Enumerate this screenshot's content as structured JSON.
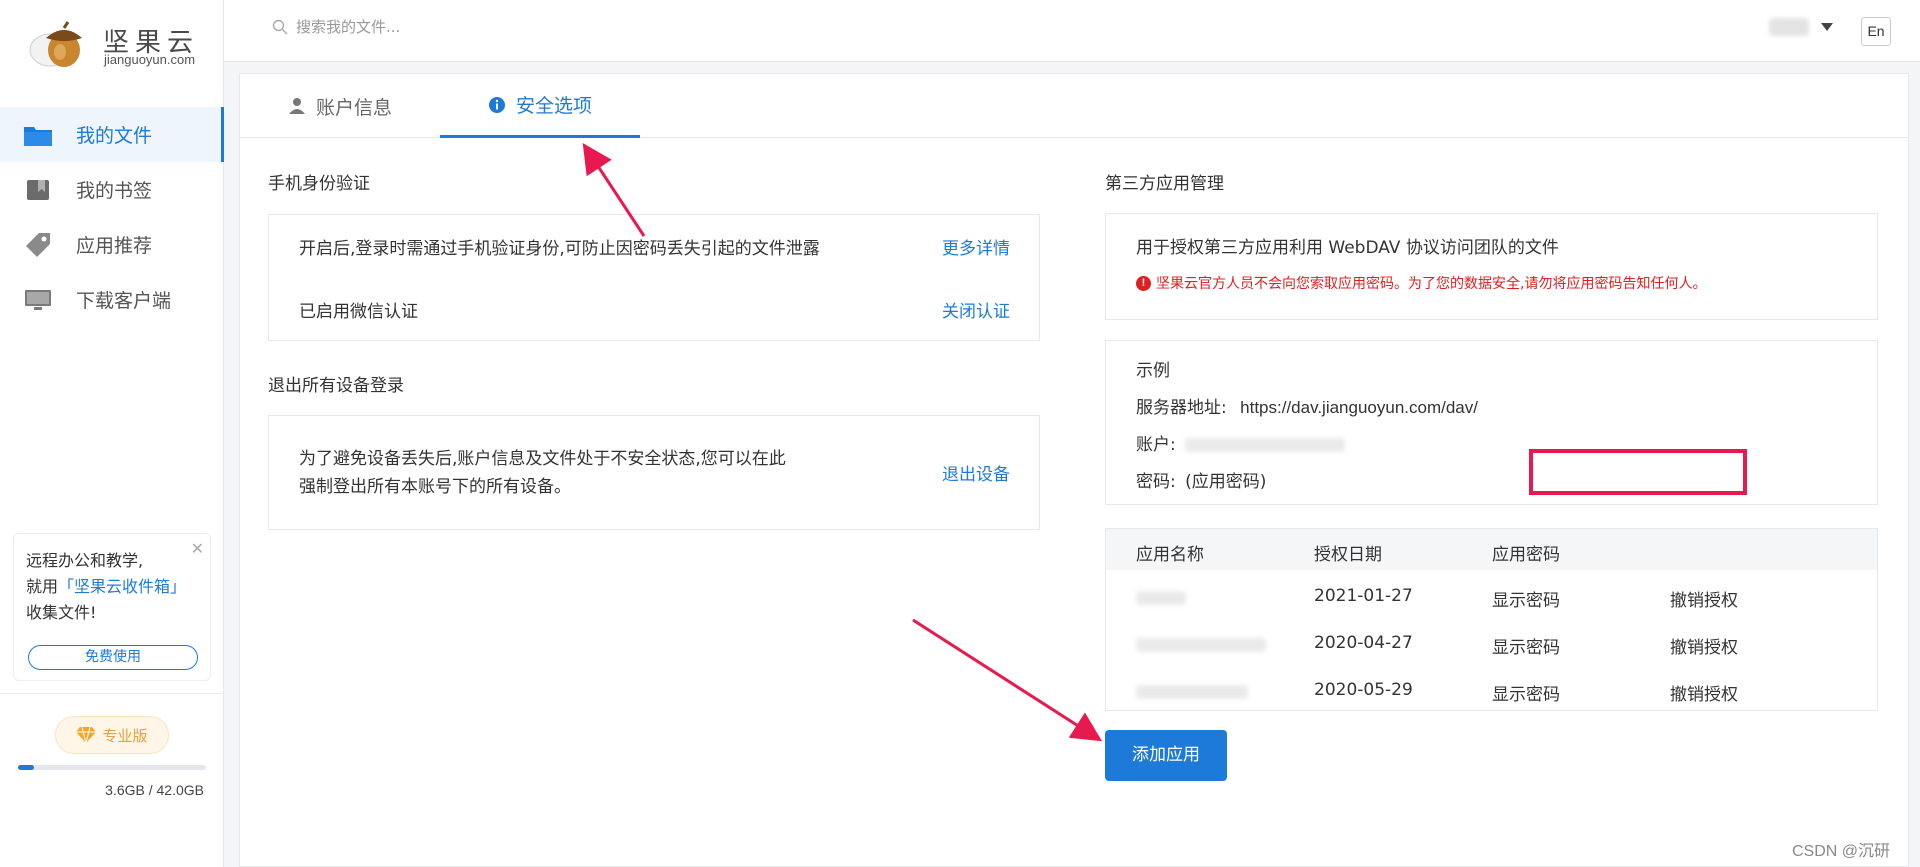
{
  "brand": {
    "name": "坚果云",
    "domain": "jianguoyun.com"
  },
  "sidebar": {
    "items": [
      {
        "label": "我的文件",
        "icon": "folder-icon",
        "active": true
      },
      {
        "label": "我的书签",
        "icon": "bookmark-icon",
        "active": false
      },
      {
        "label": "应用推荐",
        "icon": "tag-icon",
        "active": false
      },
      {
        "label": "下载客户端",
        "icon": "monitor-icon",
        "active": false
      }
    ],
    "promo": {
      "line1": "远程办公和教学,",
      "line2_prefix": "就用",
      "line2_highlight": "「坚果云收件箱」",
      "line3": "收集文件!",
      "close": "✕",
      "button": "免费使用"
    },
    "plan": {
      "label": "专业版",
      "icon": "diamond-icon"
    },
    "quota": {
      "text": "3.6GB / 42.0GB",
      "fraction": 0.0857
    }
  },
  "topbar": {
    "search_placeholder": "搜索我的文件...",
    "lang": "En"
  },
  "tabs": [
    {
      "label": "账户信息",
      "icon": "user-icon",
      "active": false
    },
    {
      "label": "安全选项",
      "icon": "info-icon",
      "active": true
    }
  ],
  "phone_auth": {
    "title": "手机身份验证",
    "desc": "开启后,登录时需通过手机验证身份,可防止因密码丢失引起的文件泄露",
    "more": "更多详情",
    "status": "已启用微信认证",
    "close": "关闭认证"
  },
  "logout_all": {
    "title": "退出所有设备登录",
    "desc_line1": "为了避免设备丢失后,账户信息及文件处于不安全状态,您可以在此",
    "desc_line2": "强制登出所有本账号下的所有设备。",
    "action": "退出设备"
  },
  "third_party": {
    "title": "第三方应用管理",
    "desc": "用于授权第三方应用利用 WebDAV 协议访问团队的文件",
    "warning": "坚果云官方人员不会向您索取应用密码。为了您的数据安全,请勿将应用密码告知任何人。",
    "example": {
      "title": "示例",
      "server_label": "服务器地址:",
      "server_url": "https://dav.jianguoyun.com/dav/",
      "account_label": "账户:",
      "password_label": "密码:",
      "password_value": "(应用密码)"
    },
    "table": {
      "headers": [
        "应用名称",
        "授权日期",
        "应用密码"
      ],
      "rows": [
        {
          "date": "2021-01-27",
          "show": "显示密码",
          "revoke": "撤销授权"
        },
        {
          "date": "2020-04-27",
          "show": "显示密码",
          "revoke": "撤销授权"
        },
        {
          "date": "2020-05-29",
          "show": "显示密码",
          "revoke": "撤销授权"
        }
      ]
    },
    "add_button": "添加应用"
  },
  "watermark": "CSDN @沉研",
  "colors": {
    "accent": "#1e7ad9",
    "annotation": "#e8194f",
    "warning": "#e02020"
  }
}
